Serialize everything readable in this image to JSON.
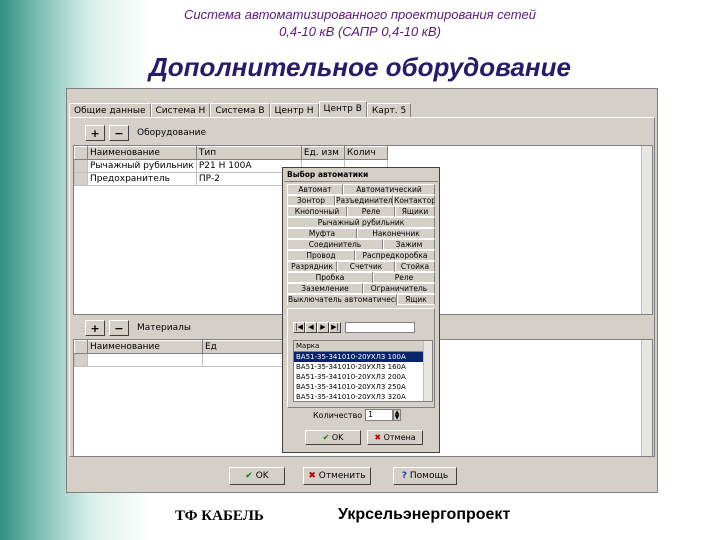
{
  "slide": {
    "title_line1": "Система автоматизированного проектирования сетей",
    "title_line2": "0,4-10 кВ (САПР 0,4-10 кВ)",
    "heading": "Дополнительное оборудование",
    "footer_left": "ТФ КАБЕЛЬ",
    "footer_right": "Укрсельэнергопроект"
  },
  "window": {
    "tabs": [
      "Общие данные",
      "Система Н",
      "Система В",
      "Центр Н",
      "Центр В",
      "Карт. 5"
    ],
    "active_tab": 4,
    "equipment_section": {
      "add_label": "+",
      "remove_label": "−",
      "title": "Оборудование",
      "columns": [
        "Наименование",
        "Тип",
        "Ед. изм",
        "Колич"
      ],
      "rows": [
        [
          "Рычажный рубильник",
          "Р21 Н 100А",
          "",
          ""
        ],
        [
          "Предохранитель",
          "ПР-2",
          "",
          ""
        ]
      ]
    },
    "materials_section": {
      "add_label": "+",
      "remove_label": "−",
      "title": "Материалы",
      "columns": [
        "Наименование",
        "Ед"
      ]
    },
    "buttons": {
      "ok": "OK",
      "cancel": "Отменить",
      "help": "Помощь"
    }
  },
  "popup": {
    "title": "Выбор автоматики",
    "tabs_rows": [
      [
        "Автомат",
        "Автоматический"
      ],
      [
        "Зонтор",
        "Разъединитель",
        "Контактор"
      ],
      [
        "Кнопочный",
        "Реле",
        "Ящики"
      ],
      [
        "Рычажный рубильник"
      ],
      [
        "Муфта",
        "Наконечник"
      ],
      [
        "Соединитель",
        "Зажим"
      ],
      [
        "Провод",
        "Распредкоробка"
      ],
      [
        "Разрядник",
        "Счетчик",
        "Стойка"
      ],
      [
        "Пробка",
        "Реле"
      ],
      [
        "Заземление",
        "Ограничитель"
      ],
      [
        "Выключатель автоматический",
        "Ящик"
      ]
    ],
    "list_header": "Марка",
    "list_items": [
      "ВА51-35-341010-20УХЛ3 100А",
      "ВА51-35-341010-20УХЛ3 160А",
      "ВА51-35-341010-20УХЛ3 200А",
      "ВА51-35-341010-20УХЛ3 250А",
      "ВА51-35-341010-20УХЛ3 320А"
    ],
    "selected_index": 0,
    "quantity_label": "Количество",
    "quantity_value": "1",
    "ok": "OK",
    "cancel": "Отмена"
  },
  "colors": {
    "window_bg": "#d4d0c8",
    "selection": "#0a246a",
    "title_purple": "#5a1a7a",
    "heading_navy": "#2a1a6a"
  }
}
